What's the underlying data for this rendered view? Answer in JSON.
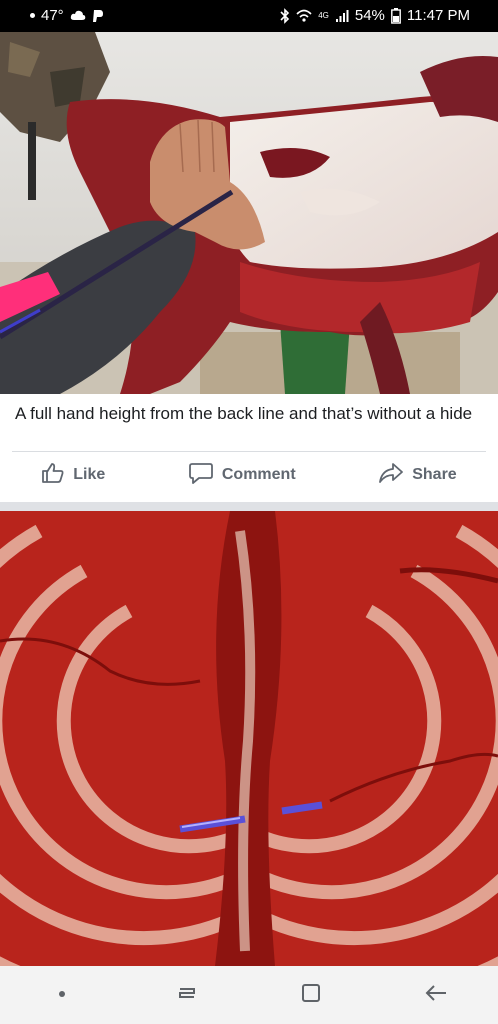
{
  "status_bar": {
    "temperature": "47°",
    "battery_percent": "54%",
    "time": "11:47 PM",
    "network": "4G",
    "icons": [
      "cloud-icon",
      "p-app-icon",
      "bluetooth-icon",
      "wifi-icon",
      "signal-icon",
      "battery-icon"
    ]
  },
  "post": {
    "caption": "A full hand height from the back line and that’s without a hide",
    "actions": {
      "like": "Like",
      "comment": "Comment",
      "share": "Share"
    }
  },
  "nav_bar": {
    "icons": [
      "dot-icon",
      "recent-apps-icon",
      "home-icon",
      "back-icon"
    ]
  },
  "colors": {
    "facebook_gray": "#606770",
    "text_dark": "#1c1e21",
    "status_bar_bg": "#000000",
    "nav_bar_bg": "#f3f3f3"
  }
}
